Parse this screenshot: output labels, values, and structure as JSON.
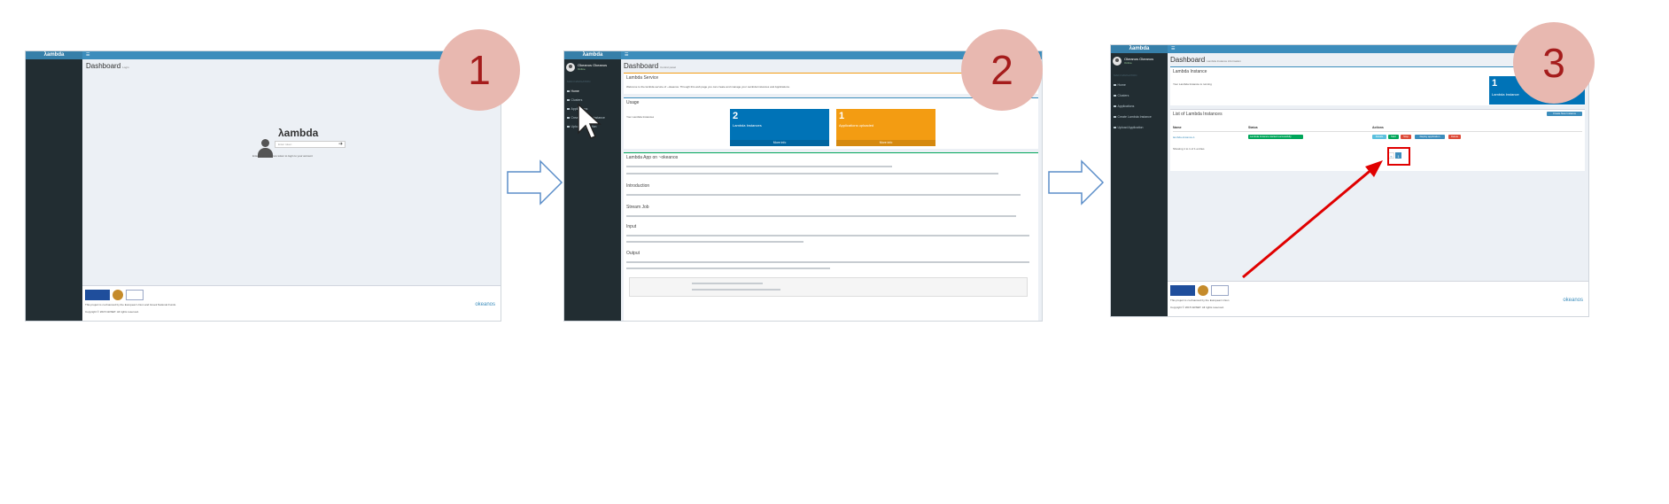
{
  "steps": [
    {
      "number": "1"
    },
    {
      "number": "2"
    },
    {
      "number": "3"
    }
  ],
  "brand": "λambda",
  "screen1": {
    "header_title": "Dashboard",
    "header_sub": "Login",
    "login_title": "λambda",
    "token_placeholder": "Enter token",
    "login_hint": "Enter your ~okeanos token to login to your account",
    "footer_line1": "This project is co-financed by the European Union and Greek National Funds",
    "footer_line2": "Copyright © 2015 GRNET. All rights reserved.",
    "footer_logo": "okeanos"
  },
  "screen2": {
    "user_name": "Okeanos Okeanos",
    "user_status": "Online",
    "nav_header": "MAIN NAVIGATION",
    "nav_items": [
      "Home",
      "Clusters",
      "Applications",
      "Create Lambda Instance",
      "Upload Application"
    ],
    "content_title": "Dashboard",
    "content_sub": "Control panel",
    "welcome_title": "Lambda Service",
    "welcome_text": "Welcome to the lambda service of ~okeanos. Through this web page you can create and manage your Lambda Instances and Applications.",
    "usage_title": "Usage",
    "usage_text": "Your Lambda Instances",
    "box_instances_num": "2",
    "box_instances_label": "Lambda Instances",
    "box_instances_more": "More info",
    "box_apps_num": "1",
    "box_apps_label": "Applications uploaded",
    "box_apps_more": "More info",
    "intro_title": "Lambda App on ~okeanos",
    "intro_section": "Introduction",
    "job_section": "Stream Job",
    "input_section": "Input",
    "output_section": "Output"
  },
  "screen3": {
    "content_title": "Dashboard",
    "content_sub": "Lambda Instance information",
    "nav_items": [
      "Home",
      "Clusters",
      "Applications",
      "Create Lambda Instance",
      "Upload Application"
    ],
    "details_title": "Lambda Instance",
    "details_text": "Your Lambda Instance is running",
    "summary_num": "1",
    "summary_label": "Lambda Instance",
    "list_title": "List of Lambda Instances",
    "new_button": "Create New Instance",
    "columns": [
      "Name",
      "Status",
      "Actions"
    ],
    "row_name": "lambda-instance-1",
    "row_status": "Lambda Instance started successfully",
    "actions": [
      "Details",
      "Start",
      "Stop",
      "Deploy application",
      "Delete"
    ],
    "pagination_text": "Showing 1 to 1 of 1 entries",
    "pages": [
      "«",
      "1"
    ],
    "footer_line1": "This project is co-financed by the European Union",
    "footer_line2": "Copyright © 2015 GRNET. All rights reserved.",
    "footer_logo": "okeanos"
  },
  "colors": {
    "header_blue": "#3c8dbc",
    "sidebar_dark": "#222d32",
    "step_circle": "#e8b8b0",
    "step_number": "#a51c1c",
    "highlight_red": "#e00000",
    "box_blue": "#0073b7",
    "box_orange": "#f39c12"
  }
}
